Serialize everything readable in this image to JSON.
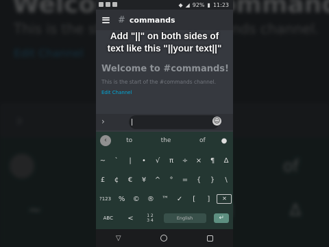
{
  "background": {
    "title": "Welcome to #commands!",
    "subtitle": "This is the start of the #commands channel.",
    "link": "Edit Channel",
    "row1": [
      "to",
      "the",
      "of"
    ],
    "row2": [
      "~",
      "`",
      "|",
      "•",
      "√",
      "π",
      "÷",
      "×",
      "¶",
      "Δ"
    ]
  },
  "status_bar": {
    "battery": "92%",
    "time": "11:23"
  },
  "app_bar": {
    "hash": "#",
    "channel": "commands"
  },
  "banner": {
    "line1": "Add \"||\" on both sides of",
    "line2": "text like this \"||your text||\""
  },
  "chat": {
    "welcome": "Welcome to #commands!",
    "start": "This is the start of the #commands channel.",
    "edit": "Edit Channel"
  },
  "keyboard": {
    "suggestions": [
      "to",
      "the",
      "of"
    ],
    "row1": [
      "~",
      "`",
      "|",
      "•",
      "√",
      "π",
      "÷",
      "×",
      "¶",
      "Δ"
    ],
    "row2": [
      "£",
      "¢",
      "€",
      "¥",
      "^",
      "°",
      "=",
      "{",
      "}",
      "\\"
    ],
    "row3": [
      "%",
      "©",
      "®",
      "™",
      "✓",
      "[",
      "]"
    ],
    "row3_left": "?123",
    "abc": "ABC",
    "lt": "<",
    "nums_top": "1 2",
    "nums_bottom": "3 4",
    "space": "English",
    "enter": "↵"
  },
  "icons": [
    "menu-icon",
    "hash-icon",
    "chevron-right-icon",
    "emoji-icon",
    "back-arrow-icon",
    "mic-icon",
    "backspace-icon",
    "nav-back-icon",
    "nav-home-icon",
    "nav-recents-icon"
  ]
}
